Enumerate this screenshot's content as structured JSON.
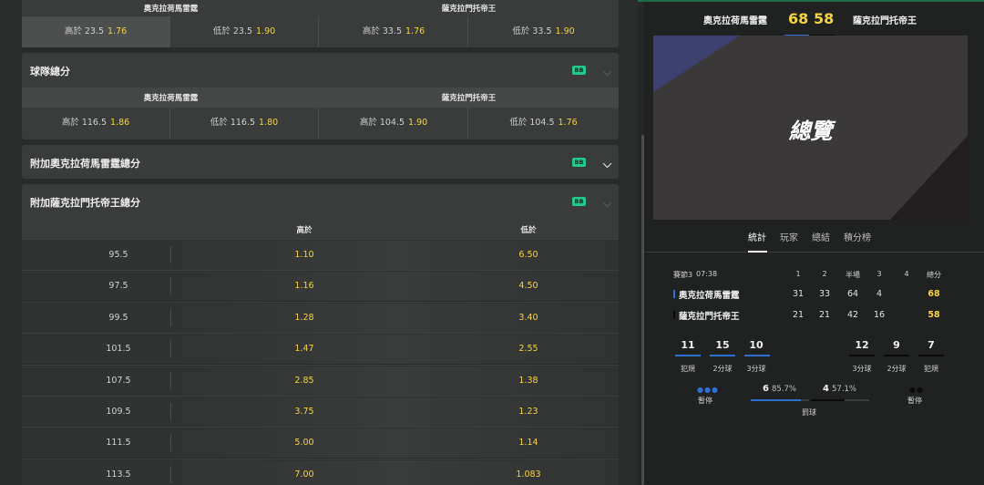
{
  "teams": {
    "home": "奧克拉荷馬雷霆",
    "away": "薩克拉門托帝王"
  },
  "colors": {
    "accent_yellow": "#f5d33a",
    "badge_green": "#22c98a",
    "home_color": "#2f6fd0",
    "away_color": "#111111"
  },
  "top_market": {
    "headers": [
      "奧克拉荷馬雷霆",
      "薩克拉門托帝王"
    ],
    "cells": [
      {
        "label": "高於 23.5",
        "odds": "1.76"
      },
      {
        "label": "低於 23.5",
        "odds": "1.90"
      },
      {
        "label": "高於 33.5",
        "odds": "1.76"
      },
      {
        "label": "低於 33.5",
        "odds": "1.90"
      }
    ]
  },
  "team_totals": {
    "title": "球隊總分",
    "badge": "BB",
    "headers": [
      "奧克拉荷馬雷霆",
      "薩克拉門托帝王"
    ],
    "cells": [
      {
        "label": "高於 116.5",
        "odds": "1.86"
      },
      {
        "label": "低於 116.5",
        "odds": "1.80"
      },
      {
        "label": "高於 104.5",
        "odds": "1.90"
      },
      {
        "label": "低於 104.5",
        "odds": "1.76"
      }
    ]
  },
  "extra_home": {
    "title": "附加奧克拉荷馬雷霆總分",
    "badge": "BB"
  },
  "extra_away": {
    "title": "附加薩克拉門托帝王總分",
    "badge": "BB",
    "col_over": "高於",
    "col_under": "低於",
    "rows": [
      {
        "line": "95.5",
        "over": "1.10",
        "under": "6.50"
      },
      {
        "line": "97.5",
        "over": "1.16",
        "under": "4.50"
      },
      {
        "line": "99.5",
        "over": "1.28",
        "under": "3.40"
      },
      {
        "line": "101.5",
        "over": "1.47",
        "under": "2.55"
      },
      {
        "line": "107.5",
        "over": "2.85",
        "under": "1.38"
      },
      {
        "line": "109.5",
        "over": "3.75",
        "under": "1.23"
      },
      {
        "line": "111.5",
        "over": "5.00",
        "under": "1.14"
      },
      {
        "line": "113.5",
        "over": "7.00",
        "under": "1.083"
      }
    ]
  },
  "scoreboard": {
    "home_score": "68",
    "away_score": "58"
  },
  "hero": {
    "title": "總覽"
  },
  "tabs": [
    "統計",
    "玩家",
    "總結",
    "積分榜"
  ],
  "boxscore": {
    "period": "賽節3",
    "clock": "07:38",
    "headers": [
      "1",
      "2",
      "半場",
      "3",
      "4",
      "總分"
    ],
    "home": [
      "31",
      "33",
      "64",
      "4",
      "",
      "68"
    ],
    "away": [
      "21",
      "21",
      "42",
      "16",
      "",
      "58"
    ]
  },
  "stats": {
    "home": {
      "fouls": "11",
      "two_pt": "15",
      "three_pt": "10"
    },
    "away": {
      "three_pt": "12",
      "two_pt": "9",
      "fouls": "7"
    },
    "labels": {
      "fouls": "犯規",
      "two_pt": "2分球",
      "three_pt": "3分球",
      "timeout": "暫停",
      "free_throw": "罰球"
    },
    "ft_home": {
      "made": "6",
      "pct": "85.7%",
      "pct_value": 0.857
    },
    "ft_away": {
      "made": "4",
      "pct": "57.1%",
      "pct_value": 0.571
    }
  }
}
